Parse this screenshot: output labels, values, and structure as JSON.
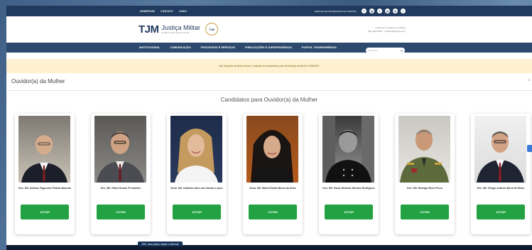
{
  "topbar": {
    "links": [
      "HOMEPAGE",
      "CONTATO",
      "LINKS"
    ],
    "info": "SERVIÇO DE INFORMAÇÃO AO CIDADÃO",
    "social": [
      "f",
      "ig",
      "t",
      "yt",
      "in",
      "r"
    ]
  },
  "header": {
    "logo_text": "TJM",
    "title": "Justiça Militar",
    "subtitle": "Estado do Rio Grande do Sul",
    "seal": "TJM",
    "contact_lines": [
      "Ouvidoria | Ouvidoria | Contatos",
      "(51) 3000-0000 · ouvidoria@tjmrs.jus.br"
    ]
  },
  "nav": {
    "items": [
      "INSTITUCIONAL",
      "COMUNICAÇÃO",
      "PROCESSOS E SERVIÇOS",
      "PUBLICAÇÕES E JURISPRUDÊNCIA",
      "PORTAL TRANSPARÊNCIA"
    ],
    "search_placeholder": "Pesquisar..."
  },
  "notice": "Olá, Eduardo de Borba Severo, Votação em andamento para Ouvidor(a) da Mulher 2026/2027",
  "page": {
    "title": "Ouvidor(a) da Mulher",
    "candidates_title": "Candidatos para Ouvidor(a) da Mulher"
  },
  "candidates": [
    {
      "name": "Des. Mil. Amilcar Fagundes Freitas Macedo",
      "vote": "VOTAR"
    },
    {
      "name": "Des. Mil. Fabio Duarte Fernandes",
      "vote": "VOTAR"
    },
    {
      "name": "Desa. Mil. Gabriela Jahn dos Santos Lopes",
      "vote": "VOTAR"
    },
    {
      "name": "Desa. Mil. Maria Emília Moura da Silva",
      "vote": "VOTAR"
    },
    {
      "name": "Des. Mil. Paulo Roberto Mendes Rodrigues",
      "vote": "VOTAR"
    },
    {
      "name": "Des. Mil. Rodrigo Mohr Picon",
      "vote": "VOTAR"
    },
    {
      "name": "Des. Mil. Sérgio Antônio Berni de Brum",
      "vote": "VOTAR"
    }
  ],
  "footer": {
    "tag": "JMS, uma justiça rápida e eficiente"
  },
  "colors": {
    "dark_blue": "#1f3a5c",
    "nav_blue": "#2d4a6e",
    "vote_green": "#23a243",
    "notice_bg": "#fdf1cf",
    "gold": "#c8a24a"
  }
}
